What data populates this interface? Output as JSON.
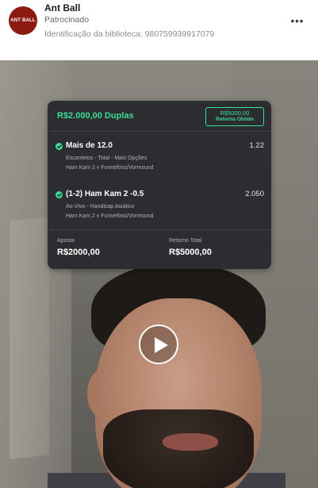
{
  "ad": {
    "page_name": "Ant Ball",
    "sponsored_label": "Patrocinado",
    "library_id": "Identificação da biblioteca: 980759939917079",
    "avatar_logo": "ANT BALL",
    "menu_icon": "more-options-icon"
  },
  "bet_slip": {
    "title": "R$2.000,00 Duplas",
    "return_amount": "R$5000,00",
    "return_label": "Retorno Obtido",
    "selections": [
      {
        "title": "Mais de 12.0",
        "odds": "1.22",
        "market": "Escanteios - Total - Mais Opções",
        "match": "Ham Kam 2 v Funnefoss/Vormsund"
      },
      {
        "title": "(1-2) Ham Kam 2 -0.5",
        "odds": "2.050",
        "market": "Ao-Vivo - Handicap Asiático",
        "match": "Ham Kam 2 v Funnefoss/Vormsund"
      }
    ],
    "stake_label": "Aposta",
    "stake_value": "R$2000,00",
    "total_return_label": "Retorno Total",
    "total_return_value": "R$5000,00"
  },
  "video": {
    "play_icon": "play-icon"
  },
  "colors": {
    "accent": "#3ddc97",
    "card_bg": "#2b2d31",
    "brand": "#8c1a10"
  }
}
